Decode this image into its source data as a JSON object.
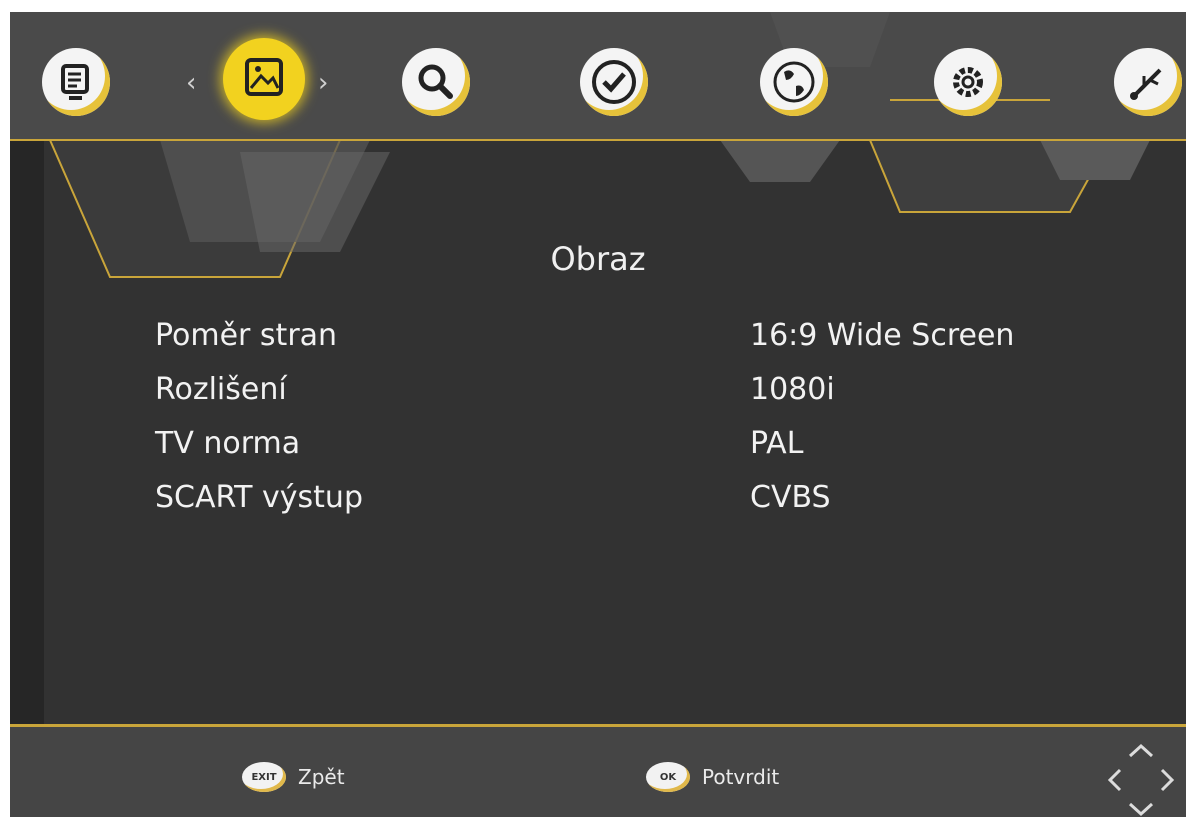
{
  "top_nav": {
    "items": [
      {
        "id": "program-guide",
        "icon": "tv-list-icon",
        "active": false
      },
      {
        "id": "picture",
        "icon": "picture-icon",
        "active": true
      },
      {
        "id": "search",
        "icon": "search-icon",
        "active": false
      },
      {
        "id": "time",
        "icon": "clock-icon",
        "active": false
      },
      {
        "id": "language",
        "icon": "globe-icon",
        "active": false
      },
      {
        "id": "system",
        "icon": "gear-icon",
        "active": false
      },
      {
        "id": "usb",
        "icon": "usb-icon",
        "active": false
      }
    ],
    "prev_arrow": "‹",
    "next_arrow": "›"
  },
  "page": {
    "title": "Obraz"
  },
  "settings": [
    {
      "label": "Poměr stran",
      "value": "16:9 Wide Screen"
    },
    {
      "label": "Rozlišení",
      "value": "1080i"
    },
    {
      "label": "TV norma",
      "value": "PAL"
    },
    {
      "label": "SCART výstup",
      "value": "CVBS"
    }
  ],
  "footer": {
    "back": {
      "key": "EXIT",
      "label": "Zpět"
    },
    "confirm": {
      "key": "OK",
      "label": "Potvrdit"
    },
    "dpad_icon": "dpad-arrows-icon"
  },
  "colors": {
    "accent": "#f2d21f",
    "line": "#c9a53a",
    "background": "#323232",
    "bar": "#4a4a4a"
  }
}
